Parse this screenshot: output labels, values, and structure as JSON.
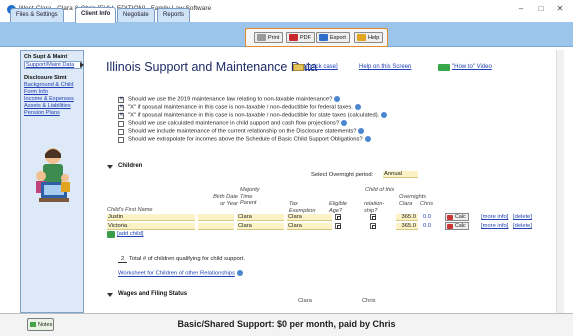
{
  "window": {
    "title": "West-Clara - Clara & Chris [FULL EDITION] - Family Law Software",
    "minimize": "–",
    "maximize": "□",
    "close": "✕"
  },
  "tabs": [
    {
      "label": "Files & Settings",
      "active": false
    },
    {
      "label": "Client Info",
      "active": true
    },
    {
      "label": "Negotiate",
      "active": false
    },
    {
      "label": "Reports",
      "active": false
    }
  ],
  "toolbar": {
    "print": "Print",
    "pdf": "PDF",
    "export": "Export",
    "help": "Help",
    "icons": [
      "printer-icon",
      "pdf-icon",
      "export-icon",
      "help-icon"
    ]
  },
  "sidebar": {
    "section1_title": "Ch Supt & Maint",
    "active_item": "Support/Maint Data",
    "section2_title": "Disclosure Stmt",
    "links": [
      "Background & Child",
      "Form Info",
      "Income & Expenses",
      "Assets & Liabilities",
      "Pension Plans"
    ]
  },
  "page": {
    "title": "Illinois Support and Maintenance Data",
    "quick_case": "[quick case]",
    "help_link": "Help on this Screen",
    "video_link": "\"How to\" Video"
  },
  "questions": [
    {
      "text": "Should we use the 2019 maintenance law relating to non-taxable maintenance?",
      "checked": true
    },
    {
      "text": "\"X\" if spousal maintenance in this case is non-taxable / non-deductible for federal taxes.",
      "checked": true
    },
    {
      "text": "\"X\" if spousal maintenance in this case is non-taxable / non-deductible for state taxes (calculated).",
      "checked": true
    },
    {
      "text": "Should we use calculated maintenance in child support and cash flow projections?",
      "checked": false
    },
    {
      "text": "Should we include maintenance of the current relationship on the Disclosure statements?",
      "checked": false
    },
    {
      "text": "Should we extrapolate for incomes above the Schedule of Basic Child Support Obligations?",
      "checked": false
    }
  ],
  "children": {
    "section_title": "Children",
    "overnight_label": "Select Overnight period:",
    "overnight_value": "Annual",
    "headers": {
      "first_name": "Child's First Name",
      "birth": "Birth Date\nor Year",
      "majority": "Majority\nTime\nParent",
      "tax": "Tax\nExemption",
      "eligible": "Eligible\nAge?",
      "child_of": "Child of this",
      "relation": "relation-\nship?",
      "overnights": "Overnights",
      "clara": "Clara",
      "chris": "Chris"
    },
    "rows": [
      {
        "name": "Justin",
        "birth": "",
        "majority": "Clara",
        "tax": "Clara",
        "overnights": "365.0",
        "chris": "0.0",
        "calc": "Calc",
        "more": "[more info]",
        "delete": "[delete]"
      },
      {
        "name": "Victoria",
        "birth": "",
        "majority": "Clara",
        "tax": "Clara",
        "overnights": "365.0",
        "chris": "0.0",
        "calc": "Calc",
        "more": "[more info]",
        "delete": "[delete]"
      }
    ],
    "add_child": "[add child]",
    "total_count": "2",
    "total_label": "Total # of children qualifying for child support.",
    "worksheet_link": "Worksheet for Children of other Relationships"
  },
  "wages": {
    "section_title": "Wages and Filing Status",
    "col1": "Clara",
    "col2": "Chris"
  },
  "bottom": {
    "notes": "Notes",
    "summary": "Basic/Shared Support: $0 per month, paid by Chris"
  },
  "colors": {
    "tabbar": "#9cc5ec",
    "toolbar_highlight": "#e38a2a",
    "field_bg": "#fbf3c6",
    "title": "#1d2b66",
    "link": "#1f3fb5"
  }
}
